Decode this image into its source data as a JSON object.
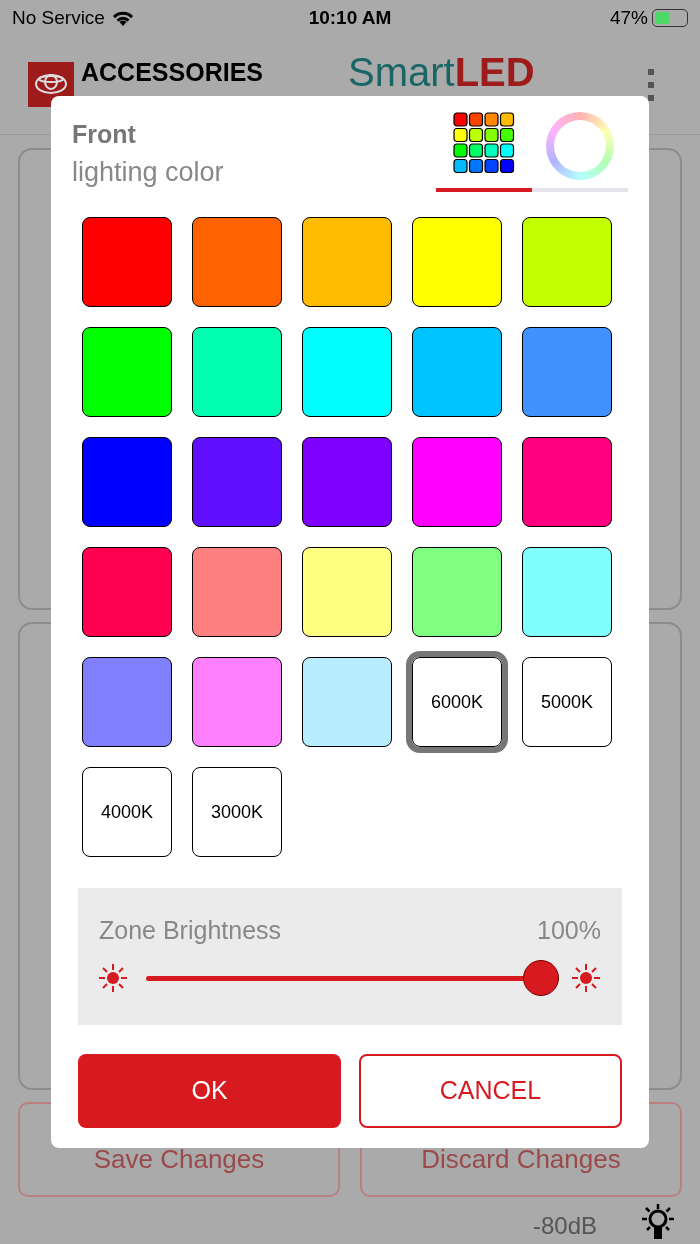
{
  "status_bar": {
    "carrier": "No Service",
    "time": "10:10 AM",
    "battery": "47%"
  },
  "header": {
    "brand": "ACCESSORIES",
    "app_title": "Smart**LED**"
  },
  "background_buttons": [
    "Save Changes",
    "Discard Changes"
  ],
  "footer": {
    "signal": "-80dB"
  },
  "dialog": {
    "title": "Front",
    "subtitle": "lighting color",
    "tabs": [
      {
        "kind": "palette",
        "selected": true
      },
      {
        "kind": "wheel",
        "selected": false
      }
    ],
    "swatches": [
      {
        "kind": "color",
        "color": "#ff0000",
        "selected": false
      },
      {
        "kind": "color",
        "color": "#ff6200",
        "selected": false
      },
      {
        "kind": "color",
        "color": "#ffbb00",
        "selected": false
      },
      {
        "kind": "color",
        "color": "#ffff00",
        "selected": false
      },
      {
        "kind": "color",
        "color": "#c4ff00",
        "selected": false
      },
      {
        "kind": "color",
        "color": "#00ff00",
        "selected": false
      },
      {
        "kind": "color",
        "color": "#00ffb0",
        "selected": false
      },
      {
        "kind": "color",
        "color": "#00ffff",
        "selected": false
      },
      {
        "kind": "color",
        "color": "#00c4ff",
        "selected": false
      },
      {
        "kind": "color",
        "color": "#4090ff",
        "selected": false
      },
      {
        "kind": "color",
        "color": "#0000ff",
        "selected": false
      },
      {
        "kind": "color",
        "color": "#6010ff",
        "selected": false
      },
      {
        "kind": "color",
        "color": "#8000ff",
        "selected": false
      },
      {
        "kind": "color",
        "color": "#ff00ff",
        "selected": false
      },
      {
        "kind": "color",
        "color": "#ff0080",
        "selected": false
      },
      {
        "kind": "color",
        "color": "#ff0050",
        "selected": false
      },
      {
        "kind": "color",
        "color": "#ff8080",
        "selected": false
      },
      {
        "kind": "color",
        "color": "#ffff80",
        "selected": false
      },
      {
        "kind": "color",
        "color": "#80ff80",
        "selected": false
      },
      {
        "kind": "color",
        "color": "#80ffff",
        "selected": false
      },
      {
        "kind": "color",
        "color": "#8080ff",
        "selected": false
      },
      {
        "kind": "color",
        "color": "#ff80ff",
        "selected": false
      },
      {
        "kind": "color",
        "color": "#b8ecff",
        "selected": false
      },
      {
        "kind": "temperature",
        "label": "6000K",
        "selected": true
      },
      {
        "kind": "temperature",
        "label": "5000K",
        "selected": false
      },
      {
        "kind": "temperature",
        "label": "4000K",
        "selected": false
      },
      {
        "kind": "temperature",
        "label": "3000K",
        "selected": false
      }
    ],
    "brightness": {
      "label": "Zone Brightness",
      "reading": "100%",
      "level": 1.0
    },
    "buttons": {
      "ok": "OK",
      "cancel": "CANCEL"
    }
  }
}
